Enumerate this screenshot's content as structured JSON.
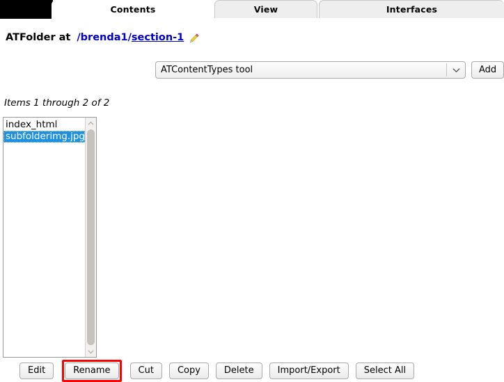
{
  "tabs": [
    {
      "label": "Contents",
      "active": true,
      "name": "tab-contents"
    },
    {
      "label": "View",
      "active": false,
      "name": "tab-view"
    },
    {
      "label": "Interfaces",
      "active": false,
      "name": "tab-interfaces"
    }
  ],
  "title": {
    "prefix": "ATFolder at",
    "path": "/brenda1/",
    "link": "section-1",
    "edit_icon": "pencil-icon"
  },
  "toolbar": {
    "selected_tool": "ATContentTypes tool",
    "tool_options": [
      "ATContentTypes tool"
    ],
    "add_label": "Add",
    "dropdown_icon": "chevron-down-icon"
  },
  "listing": {
    "count_text": "Items 1 through 2 of 2",
    "items": [
      {
        "label": "index_html",
        "selected": false
      },
      {
        "label": "subfolderimg.jpg",
        "selected": true
      }
    ],
    "scrollbar": {
      "up_icon": "chevron-up-icon",
      "down_icon": "chevron-down-icon"
    }
  },
  "actions": [
    {
      "label": "Edit",
      "name": "edit-button",
      "highlighted": false
    },
    {
      "label": "Rename",
      "name": "rename-button",
      "highlighted": true
    },
    {
      "label": "Cut",
      "name": "cut-button",
      "highlighted": false
    },
    {
      "label": "Copy",
      "name": "copy-button",
      "highlighted": false
    },
    {
      "label": "Delete",
      "name": "delete-button",
      "highlighted": false
    },
    {
      "label": "Import/Export",
      "name": "import-export-button",
      "highlighted": false
    },
    {
      "label": "Select All",
      "name": "select-all-button",
      "highlighted": false
    }
  ],
  "colors": {
    "highlight": "#ff0000",
    "link": "#0000cc",
    "selection": "#1e90e0",
    "tabbar_bg": "#000000"
  }
}
